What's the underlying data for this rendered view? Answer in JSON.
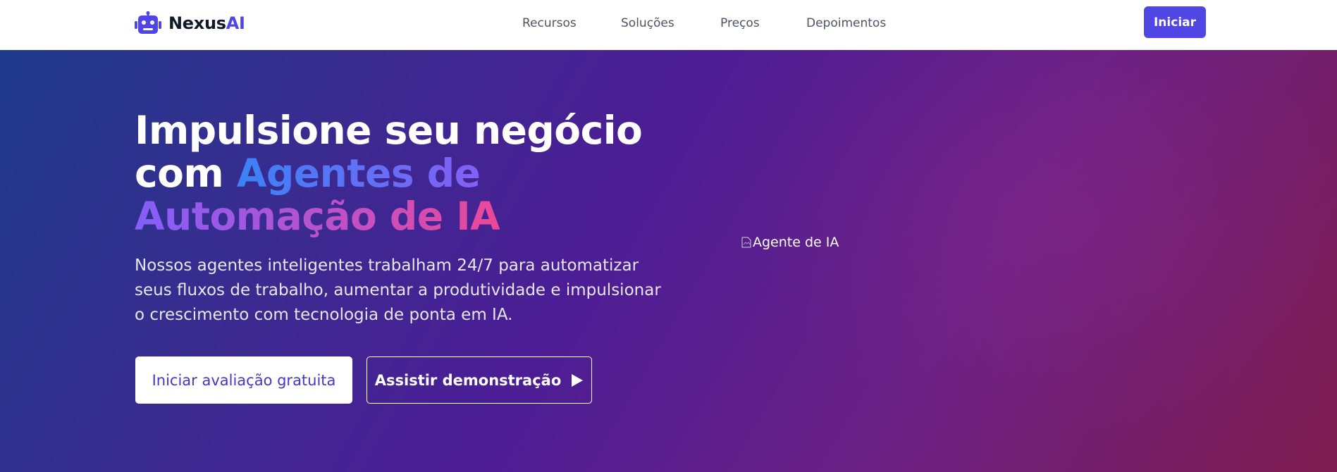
{
  "brand": {
    "name_main": "Nexus",
    "name_accent": "AI",
    "icon": "robot-icon",
    "accent_color": "#4f46e5"
  },
  "nav": {
    "links": [
      "Recursos",
      "Soluções",
      "Preços",
      "Depoimentos"
    ],
    "cta_label": "Iniciar"
  },
  "hero": {
    "headline_plain": "Impulsione seu negócio com ",
    "headline_highlight": "Agentes de Automação de IA",
    "subtext": "Nossos agentes inteligentes trabalham 24/7 para automatizar seus fluxos de trabalho, aumentar a produtividade e impulsionar o crescimento com tecnologia de ponta em IA.",
    "primary_button": "Iniciar avaliação gratuita",
    "secondary_button": "Assistir demonstração",
    "secondary_icon": "play-icon",
    "image_alt": "Agente de IA",
    "gradient_colors": [
      "#1e3a8a",
      "#4c1d95",
      "#7f1d4f"
    ]
  }
}
